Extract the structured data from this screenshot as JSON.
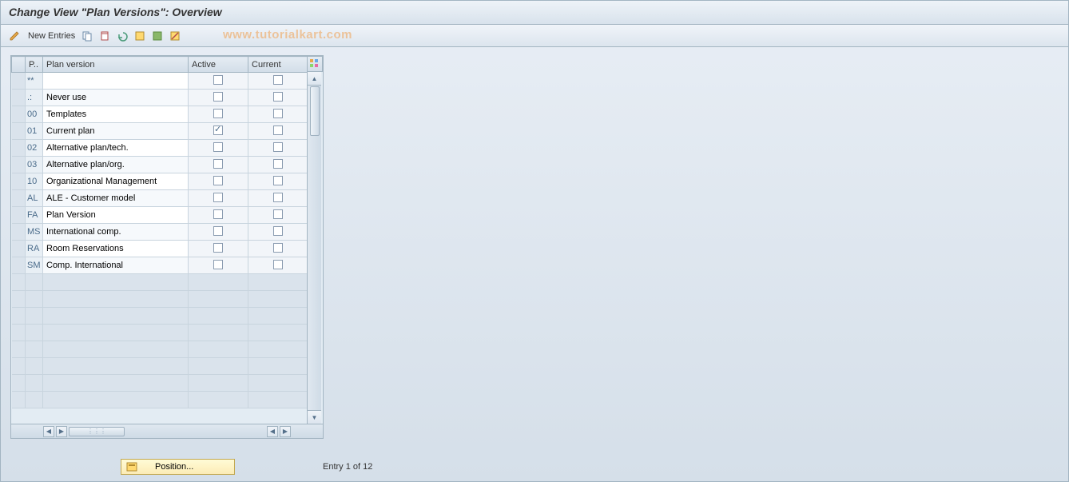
{
  "title": "Change View \"Plan Versions\": Overview",
  "toolbar": {
    "new_entries_label": "New Entries"
  },
  "watermark": "www.tutorialkart.com",
  "table": {
    "headers": {
      "code": "P..",
      "name": "Plan version",
      "active": "Active",
      "current": "Current"
    },
    "rows": [
      {
        "code": "**",
        "name": "",
        "active": false,
        "current": false
      },
      {
        "code": ".:",
        "name": "Never use",
        "active": false,
        "current": false
      },
      {
        "code": "00",
        "name": "Templates",
        "active": false,
        "current": false
      },
      {
        "code": "01",
        "name": "Current plan",
        "active": true,
        "current": false
      },
      {
        "code": "02",
        "name": "Alternative plan/tech.",
        "active": false,
        "current": false
      },
      {
        "code": "03",
        "name": "Alternative plan/org.",
        "active": false,
        "current": false
      },
      {
        "code": "10",
        "name": "Organizational Management",
        "active": false,
        "current": false
      },
      {
        "code": "AL",
        "name": "ALE - Customer model",
        "active": false,
        "current": false
      },
      {
        "code": "FA",
        "name": "Plan Version",
        "active": false,
        "current": false
      },
      {
        "code": "MS",
        "name": "International comp.",
        "active": false,
        "current": false
      },
      {
        "code": "RA",
        "name": "Room Reservations",
        "active": false,
        "current": false
      },
      {
        "code": "SM",
        "name": "Comp. International",
        "active": false,
        "current": false
      }
    ],
    "empty_rows": 8
  },
  "footer": {
    "position_label": "Position...",
    "entry_text": "Entry 1 of 12"
  }
}
